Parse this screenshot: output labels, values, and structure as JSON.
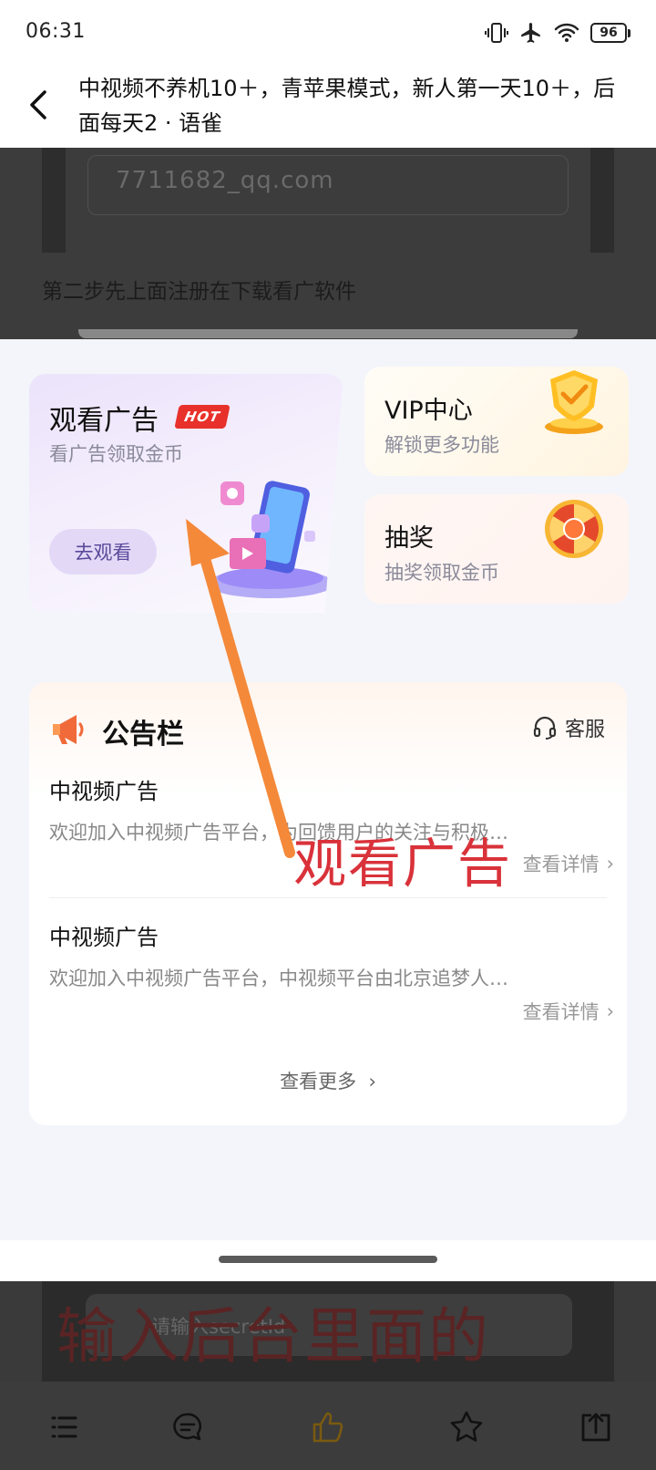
{
  "status_bar": {
    "time": "06:31",
    "battery": "96",
    "icons": [
      "vibrate-icon",
      "airplane-icon",
      "wifi-icon",
      "battery-icon"
    ]
  },
  "header": {
    "title": "中视频不养机10＋，青苹果模式，新人第一天10＋，后面每天2 · 语雀",
    "back_icon": "chevron-left-icon"
  },
  "background_doc": {
    "email_masked": "7711682_qq.com",
    "step_text": "第二步先上面注册在下载看广软件",
    "input_placeholder": "请输入secretId",
    "overlay_text": "输入后台里面的"
  },
  "cards": {
    "watch_ads": {
      "title": "观看广告",
      "badge": "HOT",
      "subtitle": "看广告领取金币",
      "button": "去观看"
    },
    "vip": {
      "title": "VIP中心",
      "subtitle": "解锁更多功能"
    },
    "lottery": {
      "title": "抽奖",
      "subtitle": "抽奖领取金币"
    }
  },
  "notice_board": {
    "title": "公告栏",
    "customer_service": "客服",
    "items": [
      {
        "title": "中视频广告",
        "body": "欢迎加入中视频广告平台，为回馈用户的关注与积极…",
        "more": "查看详情"
      },
      {
        "title": "中视频广告",
        "body": "欢迎加入中视频广告平台，中视频平台由北京追梦人…",
        "more": "查看详情"
      }
    ],
    "view_more": "查看更多"
  },
  "annotation": {
    "label": "观看广告",
    "color": "#d9323a",
    "arrow_color": "#f4893a"
  },
  "bottom_nav": [
    "list-icon",
    "comment-icon",
    "thumbs-up-icon",
    "star-icon",
    "share-icon"
  ]
}
